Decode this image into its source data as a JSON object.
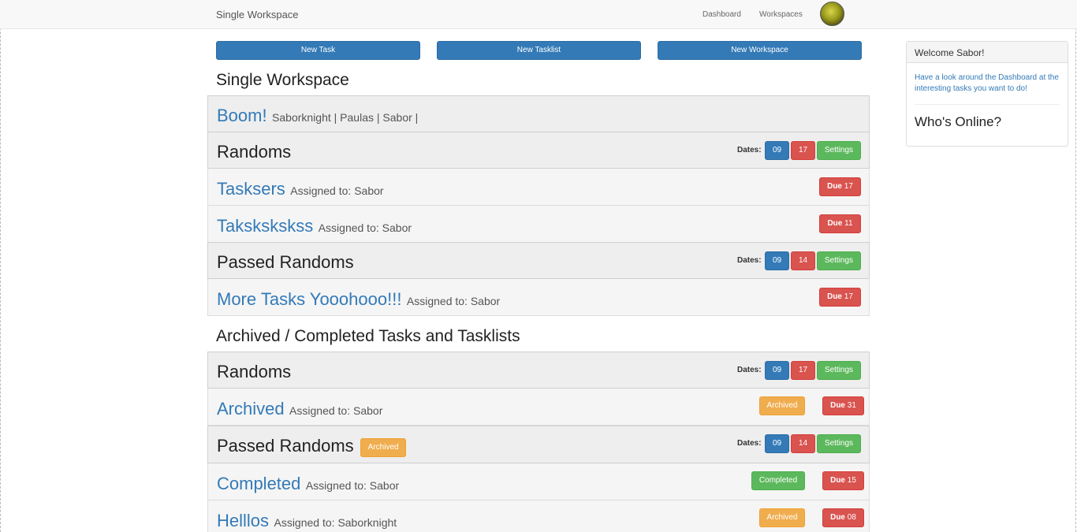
{
  "navbar": {
    "brand": "Single Workspace",
    "links": [
      "Dashboard",
      "Workspaces"
    ],
    "avatar": "user-avatar"
  },
  "toolbar": {
    "new_task": "New Task",
    "new_tasklist": "New Tasklist",
    "new_workspace": "New Workspace"
  },
  "page_title": "Single Workspace",
  "workspace": {
    "name": "Boom!",
    "members": "Saborknight | Paulas | Sabor |"
  },
  "common": {
    "dates_label": "Dates:",
    "settings": "Settings",
    "due": "Due",
    "archived": "Archived",
    "completed": "Completed",
    "assigned": "Assigned to:"
  },
  "active": {
    "lists": [
      {
        "name": "Randoms",
        "start": "09",
        "end": "17",
        "tasks": [
          {
            "name": "Tasksers",
            "assignee": "Sabor",
            "due": "17"
          },
          {
            "name": "Takskskskss",
            "assignee": "Sabor",
            "due": "11"
          }
        ]
      },
      {
        "name": "Passed Randoms",
        "start": "09",
        "end": "14",
        "tasks": [
          {
            "name": "More Tasks Yooohooo!!!",
            "assignee": "Sabor",
            "due": "17"
          }
        ]
      }
    ]
  },
  "archive_title": "Archived / Completed Tasks and Tasklists",
  "archive": {
    "lists": [
      {
        "name": "Randoms",
        "start": "09",
        "end": "17",
        "tasks": [
          {
            "name": "Archived",
            "assignee": "Sabor",
            "status": "Archived",
            "due": "31"
          }
        ]
      },
      {
        "name": "Passed Randoms",
        "status": "Archived",
        "start": "09",
        "end": "14",
        "tasks": [
          {
            "name": "Completed",
            "assignee": "Sabor",
            "status": "Completed",
            "due": "15"
          },
          {
            "name": "Helllos",
            "assignee": "Saborknight",
            "status": "Archived",
            "due": "08"
          }
        ]
      }
    ]
  },
  "sidebar": {
    "welcome": "Welcome Sabor!",
    "hint": "Have a look around the Dashboard at the interesting tasks you want to do!",
    "online_title": "Who's Online?"
  },
  "colors": {
    "primary": "#337ab7",
    "danger": "#d9534f",
    "success": "#5cb85c",
    "warning": "#f0ad4e"
  }
}
